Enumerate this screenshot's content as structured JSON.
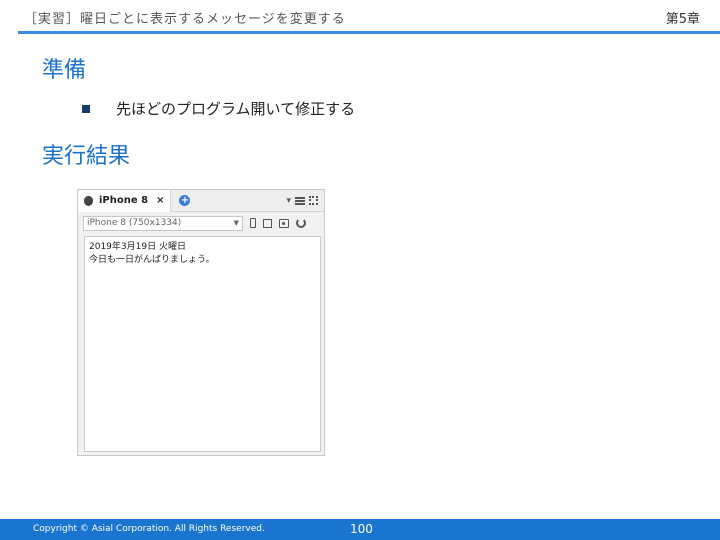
{
  "header": {
    "title": "［実習］曜日ごとに表示するメッセージを変更する",
    "chapter": "第5章",
    "accent_color": "#3a8ee6"
  },
  "sections": {
    "prep_title": "準備",
    "prep_bullet": "先ほどのプログラム開いて修正する",
    "result_title": "実行結果"
  },
  "emulator": {
    "tab_label": "iPhone 8",
    "tab_close": "×",
    "add_tab": "+",
    "dropdown_caret": "▾",
    "device_select": "iPhone 8 (750x1334)",
    "select_caret": "▼",
    "screen_lines": [
      "2019年3月19日 火曜日",
      "今日も一日がんばりましょう。"
    ],
    "icons": [
      "apple-icon",
      "add-tab-icon",
      "menu-icon",
      "expand-icon",
      "phone-icon",
      "tablet-icon",
      "screenshot-icon",
      "rotate-icon"
    ]
  },
  "footer": {
    "copyright": "Copyright © Asial Corporation. All Rights Reserved.",
    "page": "100",
    "color": "#1a75d1"
  }
}
